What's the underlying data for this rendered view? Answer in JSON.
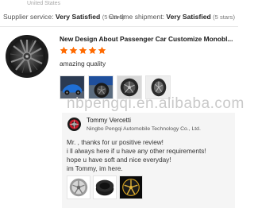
{
  "review": {
    "origin": "United States",
    "ratings": [
      {
        "label": "Supplier service:",
        "value": "Very Satisfied",
        "stars": "(5 stars)"
      },
      {
        "label": "On-time shipment:",
        "value": "Very Satisfied",
        "stars": "(5 stars)"
      }
    ],
    "product_title": "New Design About Passenger Car Customize Monobl...",
    "star_rating": 5,
    "comment": "amazing quality",
    "photo_count": 4
  },
  "watermark": "nbpengqi.en.alibaba.com",
  "reply": {
    "name": "Tommy Vercetti",
    "company": "Ningbo Pengqi Automobile Technology Co., Ltd.",
    "lines": [
      "Mr.          , thanks for ur positive review!",
      "i ll always here if u have any other requirements!",
      "hope u have soft and nice everyday!",
      "im Tommy,  im here."
    ],
    "photo_count": 3
  },
  "colors": {
    "star": "#ff6a00",
    "reply_bg": "#f5f5f5",
    "watermark": "#c9c9c9",
    "divider": "#e6e6e6"
  }
}
